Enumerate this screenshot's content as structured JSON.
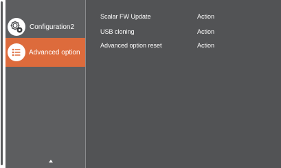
{
  "sidebar": {
    "items": [
      {
        "label": "Configuration2",
        "icon": "gear-icon",
        "selected": false
      },
      {
        "label": "Advanced option",
        "icon": "list-icon",
        "selected": true
      }
    ],
    "scroll_indicator": "scroll-up-icon"
  },
  "main": {
    "rows": [
      {
        "label": "Scalar FW Update",
        "value": "Action"
      },
      {
        "label": "USB cloning",
        "value": "Action"
      },
      {
        "label": "Advanced option reset",
        "value": "Action"
      }
    ]
  },
  "colors": {
    "sidebar_bg": "#5d5e60",
    "main_bg": "#525355",
    "accent": "#dd6b3c",
    "text": "#ffffff"
  }
}
